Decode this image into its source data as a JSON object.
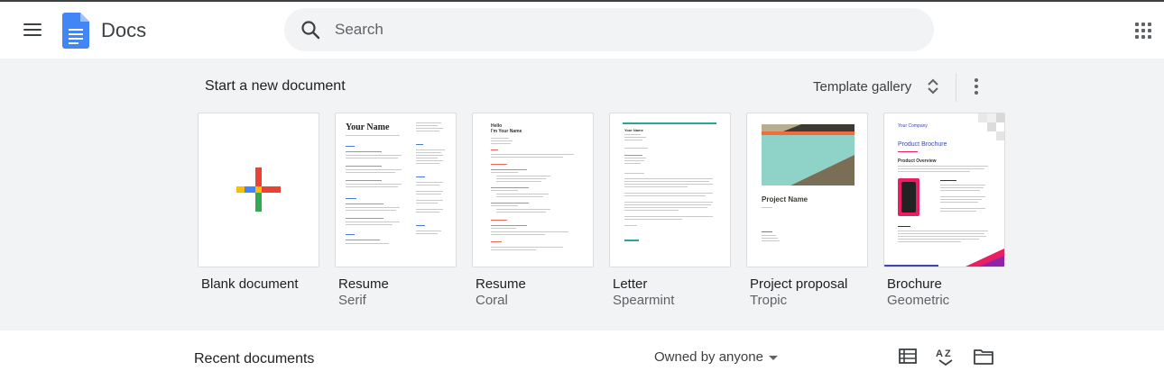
{
  "app": {
    "title": "Docs"
  },
  "search": {
    "placeholder": "Search"
  },
  "templates": {
    "heading": "Start a new document",
    "gallery_label": "Template gallery",
    "items": [
      {
        "name": "Blank document",
        "subtitle": ""
      },
      {
        "name": "Resume",
        "subtitle": "Serif",
        "heading": "Your Name"
      },
      {
        "name": "Resume",
        "subtitle": "Coral",
        "heading": "Hello\nI'm Your Name"
      },
      {
        "name": "Letter",
        "subtitle": "Spearmint",
        "heading": "Your Name"
      },
      {
        "name": "Project proposal",
        "subtitle": "Tropic",
        "heading": "Project Name"
      },
      {
        "name": "Brochure",
        "subtitle": "Geometric",
        "company": "Your Company",
        "heading": "Product Brochure",
        "section": "Product Overview"
      }
    ]
  },
  "recent": {
    "heading": "Recent documents",
    "owner_filter": "Owned by anyone"
  },
  "icons": {
    "menu": "hamburger-icon",
    "logo": "docs-logo-icon",
    "search": "search-icon",
    "apps": "apps-grid-icon",
    "sort_toggle": "unfold-icon",
    "more": "more-vert-icon",
    "list_view": "list-view-icon",
    "sort": "sort-az-icon",
    "folder": "folder-icon"
  },
  "colors": {
    "accent_blue": "#4285f4",
    "plus_red": "#ea4335",
    "plus_yellow": "#fbbc04",
    "plus_green": "#34a853",
    "tropic_teal": "#8fd3c8",
    "tropic_orange": "#f26d3d",
    "brochure_pink": "#e91e63",
    "spearmint": "#26a69a"
  }
}
